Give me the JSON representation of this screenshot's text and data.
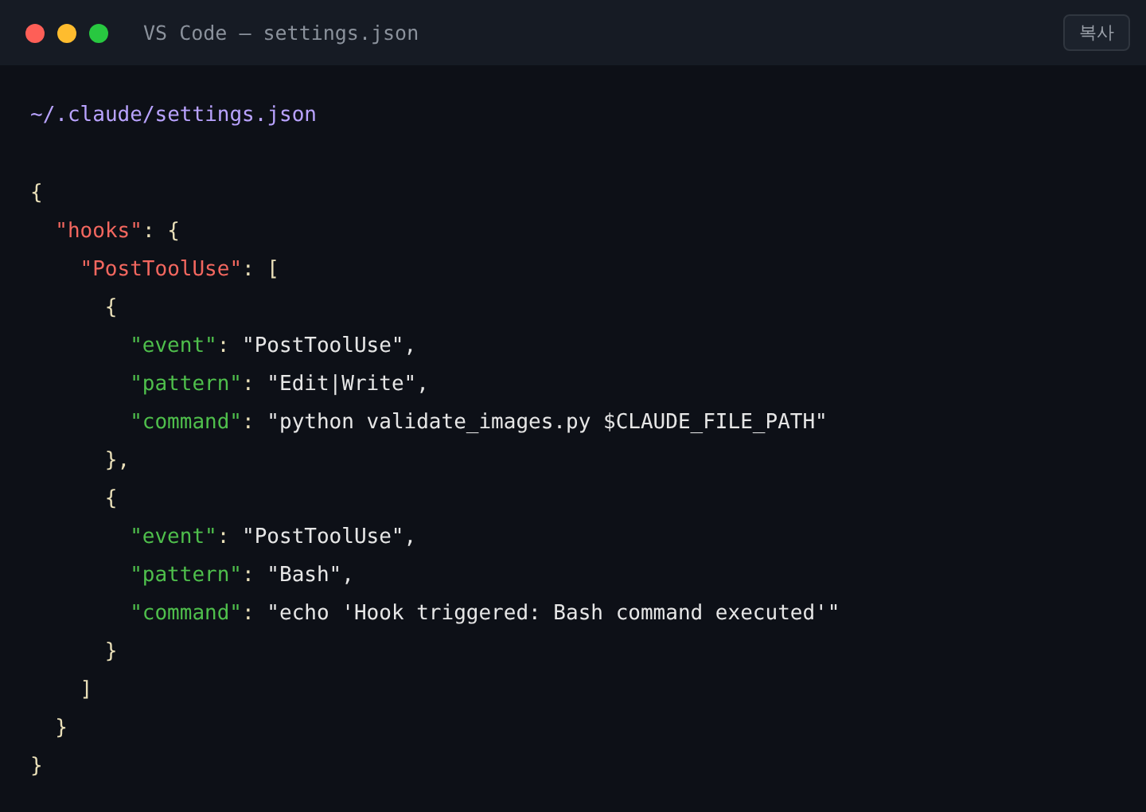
{
  "window": {
    "title": "VS Code — settings.json",
    "copy_button": "복사"
  },
  "file_path": "~/.claude/settings.json",
  "code": [
    {
      "tokens": [
        {
          "kind": "punct",
          "text": "{"
        }
      ],
      "children": [
        {
          "tokens": [
            {
              "kind": "section",
              "text": "\"hooks\""
            },
            {
              "kind": "punct",
              "text": ": {"
            }
          ],
          "children": [
            {
              "tokens": [
                {
                  "kind": "section",
                  "text": "\"PostToolUse\""
                },
                {
                  "kind": "punct",
                  "text": ": ["
                }
              ],
              "children": [
                {
                  "tokens": [
                    {
                      "kind": "punct",
                      "text": "{"
                    }
                  ],
                  "children": [
                    {
                      "tokens": [
                        {
                          "kind": "key",
                          "text": "\"event\""
                        },
                        {
                          "kind": "punct",
                          "text": ": "
                        },
                        {
                          "kind": "string",
                          "text": "\"PostToolUse\","
                        }
                      ]
                    },
                    {
                      "tokens": [
                        {
                          "kind": "key",
                          "text": "\"pattern\""
                        },
                        {
                          "kind": "punct",
                          "text": ": "
                        },
                        {
                          "kind": "string",
                          "text": "\"Edit|Write\","
                        }
                      ]
                    },
                    {
                      "tokens": [
                        {
                          "kind": "key",
                          "text": "\"command\""
                        },
                        {
                          "kind": "punct",
                          "text": ": "
                        },
                        {
                          "kind": "string",
                          "text": "\"python validate_images.py $CLAUDE_FILE_PATH\""
                        }
                      ]
                    }
                  ]
                },
                {
                  "tokens": [
                    {
                      "kind": "punct",
                      "text": "},"
                    }
                  ]
                },
                {
                  "tokens": [
                    {
                      "kind": "punct",
                      "text": "{"
                    }
                  ],
                  "children": [
                    {
                      "tokens": [
                        {
                          "kind": "key",
                          "text": "\"event\""
                        },
                        {
                          "kind": "punct",
                          "text": ": "
                        },
                        {
                          "kind": "string",
                          "text": "\"PostToolUse\","
                        }
                      ]
                    },
                    {
                      "tokens": [
                        {
                          "kind": "key",
                          "text": "\"pattern\""
                        },
                        {
                          "kind": "punct",
                          "text": ": "
                        },
                        {
                          "kind": "string",
                          "text": "\"Bash\","
                        }
                      ]
                    },
                    {
                      "tokens": [
                        {
                          "kind": "key",
                          "text": "\"command\""
                        },
                        {
                          "kind": "punct",
                          "text": ": "
                        },
                        {
                          "kind": "string",
                          "text": "\"echo 'Hook triggered: Bash command executed'\""
                        }
                      ]
                    }
                  ]
                },
                {
                  "tokens": [
                    {
                      "kind": "punct",
                      "text": "}"
                    }
                  ]
                }
              ]
            },
            {
              "tokens": [
                {
                  "kind": "punct",
                  "text": "]"
                }
              ]
            }
          ]
        },
        {
          "tokens": [
            {
              "kind": "punct",
              "text": "}"
            }
          ]
        }
      ]
    },
    {
      "tokens": [
        {
          "kind": "punct",
          "text": "}"
        }
      ]
    }
  ]
}
